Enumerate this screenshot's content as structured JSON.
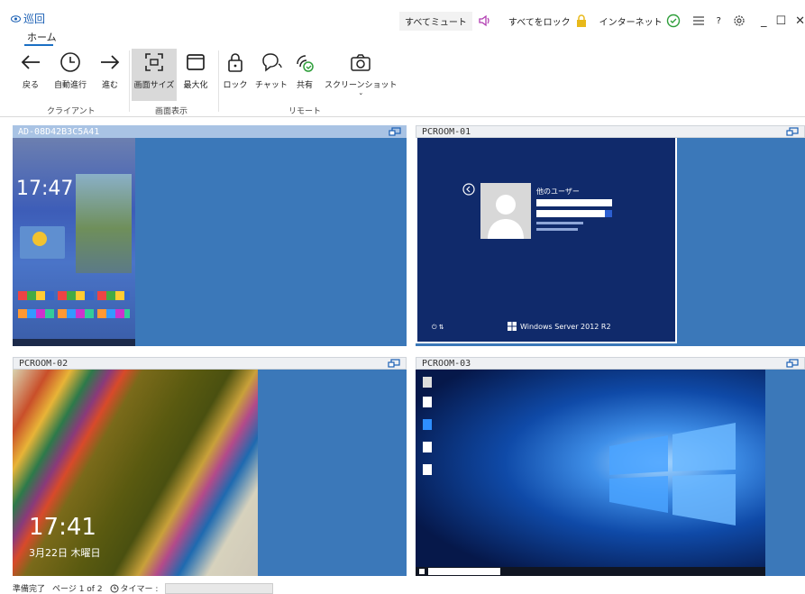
{
  "app": {
    "title": "巡回"
  },
  "tabs": {
    "home": "ホーム"
  },
  "title_actions": {
    "mute_all": "すべてミュート",
    "lock_all": "すべてをロック",
    "internet": "インターネット",
    "help": "?"
  },
  "ribbon": {
    "back": "戻る",
    "auto_advance": "自動進行",
    "forward": "進む",
    "screen_size": "画面サイズ",
    "maximize": "最大化",
    "lock": "ロック",
    "chat": "チャット",
    "share": "共有",
    "screenshot": "スクリーンショット",
    "groups": {
      "client": "クライアント",
      "display": "画面表示",
      "remote": "リモート"
    }
  },
  "panels": [
    {
      "name": "AD-08D42B3C5A41",
      "clock": "17:47"
    },
    {
      "name": "PCROOM-01",
      "other_user": "他のユーザー",
      "os": "Windows Server 2012 R2"
    },
    {
      "name": "PCROOM-02",
      "clock": "17:41",
      "date": "3月22日 木曜日"
    },
    {
      "name": "PCROOM-03"
    }
  ],
  "status": {
    "ready": "準備完了",
    "page": "ページ 1 of 2",
    "timer": "タイマー :"
  },
  "colors": {
    "accent": "#1a6fc4",
    "panel_bg": "#3b78b9",
    "header_active": "#a9c3e4"
  }
}
